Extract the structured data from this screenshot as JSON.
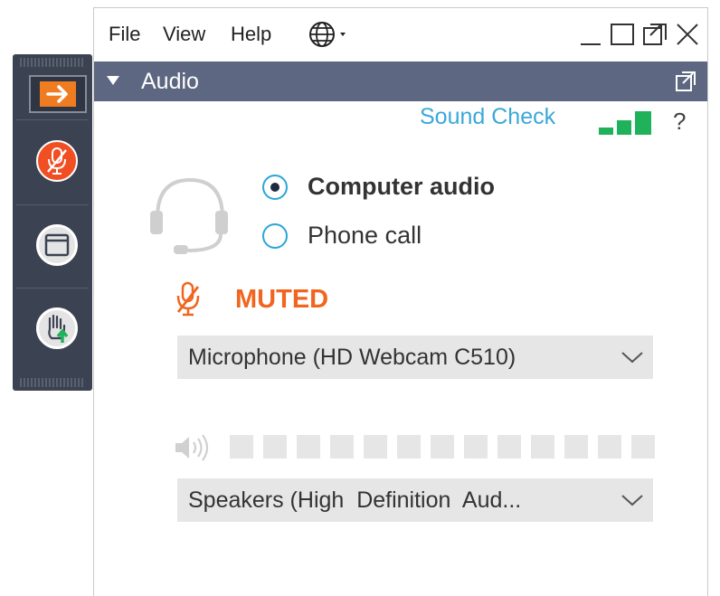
{
  "menu": {
    "file": "File",
    "view": "View",
    "help": "Help",
    "language_icon": "globe-icon"
  },
  "window_controls": {
    "minimize_icon": "minimize-icon",
    "maximize_icon": "maximize-icon",
    "popout_icon": "popout-icon",
    "close_icon": "close-icon"
  },
  "panel": {
    "title": "Audio",
    "collapse_icon": "triangle-down-icon",
    "popout_icon": "popout-icon"
  },
  "sound_check": {
    "label": "Sound Check",
    "icon": "signal-bars-icon",
    "help_label": "?"
  },
  "audio_mode": {
    "selected": "Computer audio",
    "options": [
      "Computer audio",
      "Phone call"
    ]
  },
  "mic": {
    "status": "MUTED",
    "device": "Microphone (HD Webcam C510)"
  },
  "speaker": {
    "level": 0,
    "device": "Speakers (High  Definition  Aud..."
  },
  "side_bar": {
    "items": [
      "show-panel-arrow-icon",
      "mute-microphone-icon",
      "screen-icon",
      "raise-hand-icon"
    ]
  },
  "colors": {
    "accent_orange": "#f07c22",
    "muted_red": "#f0661f",
    "link_blue": "#3aa8d8",
    "title_bar": "#5d6781",
    "signal_green": "#1fb25a",
    "sidebar": "#3b4252"
  }
}
